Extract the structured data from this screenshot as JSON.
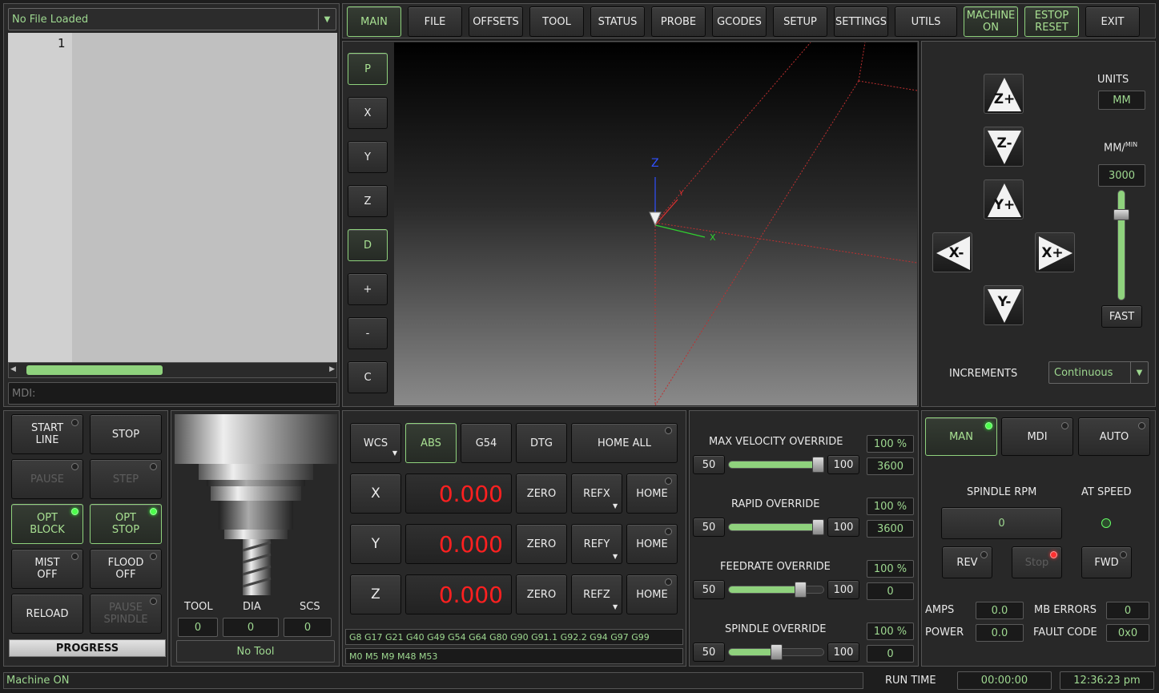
{
  "file_panel": {
    "file_combo": "No File Loaded",
    "line_number": "1",
    "mdi_placeholder": "MDI:"
  },
  "top_tabs": [
    {
      "label": "MAIN"
    },
    {
      "label": "FILE"
    },
    {
      "label": "OFFSETS"
    },
    {
      "label": "TOOL"
    },
    {
      "label": "STATUS"
    },
    {
      "label": "PROBE"
    },
    {
      "label": "GCODES"
    },
    {
      "label": "SETUP"
    },
    {
      "label": "SETTINGS"
    },
    {
      "label": "UTILS"
    }
  ],
  "top_actions": {
    "machine_on": "MACHINE ON",
    "estop": "ESTOP RESET",
    "exit": "EXIT"
  },
  "view_buttons": [
    "P",
    "X",
    "Y",
    "Z",
    "D",
    "+",
    "-",
    "C"
  ],
  "viewport": {
    "axis_x": "X",
    "axis_y": "Y",
    "axis_z": "Z"
  },
  "jog": {
    "zplus": "Z+",
    "zminus": "Z-",
    "yplus": "Y+",
    "yminus": "Y-",
    "xminus": "X-",
    "xplus": "X+",
    "units_label": "UNITS",
    "units_value": "MM",
    "rate_label": "MM/",
    "rate_sup": "MIN",
    "rate_value": "3000",
    "fast": "FAST",
    "increments_label": "INCREMENTS",
    "increments_value": "Continuous",
    "rate_slider_level": 0.81
  },
  "run_controls": {
    "start": "START LINE",
    "stop": "STOP",
    "pause": "PAUSE",
    "step": "STEP",
    "opt_block": "OPT BLOCK",
    "opt_stop": "OPT STOP",
    "mist": "MIST OFF",
    "flood": "FLOOD OFF",
    "reload": "RELOAD",
    "pause_spindle": "PAUSE SPINDLE",
    "progress": "PROGRESS"
  },
  "tool": {
    "tool_label": "TOOL",
    "dia_label": "DIA",
    "scs_label": "SCS",
    "tool_value": "0",
    "dia_value": "0",
    "scs_value": "0",
    "name": "No Tool"
  },
  "dro": {
    "wcs": "WCS",
    "abs": "ABS",
    "g54": "G54",
    "dtg": "DTG",
    "home_all": "HOME ALL",
    "axes": [
      {
        "name": "X",
        "value": "0.000",
        "ref": "REFX"
      },
      {
        "name": "Y",
        "value": "0.000",
        "ref": "REFY"
      },
      {
        "name": "Z",
        "value": "0.000",
        "ref": "REFZ"
      }
    ],
    "zero": "ZERO",
    "home": "HOME",
    "gcodes": "G8 G17 G21 G40 G49 G54 G64 G80 G90 G91.1 G92.2 G94 G97 G99",
    "mcodes": "M0 M5 M9 M48 M53"
  },
  "overrides": [
    {
      "label": "MAX VELOCITY OVERRIDE",
      "min": "50",
      "max": "100",
      "pct": "100 %",
      "value": "3600",
      "level": 1.0
    },
    {
      "label": "RAPID OVERRIDE",
      "min": "50",
      "max": "100",
      "pct": "100 %",
      "value": "3600",
      "level": 1.0
    },
    {
      "label": "FEEDRATE OVERRIDE",
      "min": "50",
      "max": "100",
      "pct": "100 %",
      "value": "0",
      "level": 0.75
    },
    {
      "label": "SPINDLE OVERRIDE",
      "min": "50",
      "max": "100",
      "pct": "100 %",
      "value": "0",
      "level": 0.5
    }
  ],
  "mode": {
    "man": "MAN",
    "mdi": "MDI",
    "auto": "AUTO"
  },
  "spindle": {
    "rpm_label": "SPINDLE RPM",
    "at_speed": "AT SPEED",
    "rpm": "0",
    "rev": "REV",
    "stop": "Stop",
    "fwd": "FWD",
    "amps_label": "AMPS",
    "amps": "0.0",
    "mb_label": "MB ERRORS",
    "mb": "0",
    "power_label": "POWER",
    "power": "0.0",
    "fault_label": "FAULT CODE",
    "fault": "0x0"
  },
  "status": {
    "message": "Machine ON",
    "run_label": "RUN TIME",
    "run_time": "00:00:00",
    "clock": "12:36:23 pm"
  },
  "colors": {
    "accent": "#8fd27d",
    "dro_red": "#ff2020"
  }
}
